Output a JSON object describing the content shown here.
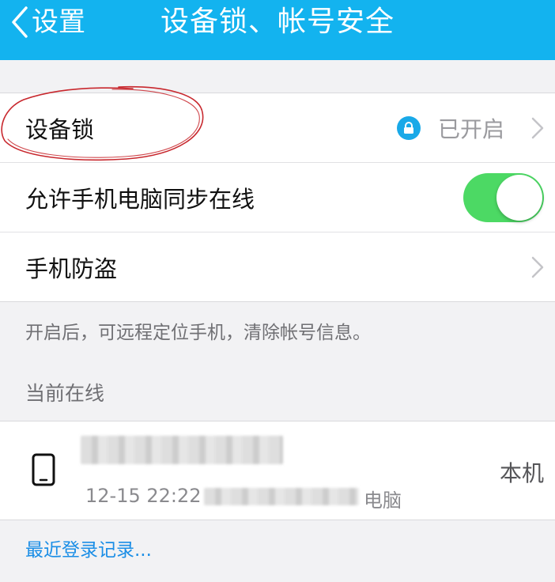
{
  "nav": {
    "back_label": "设置",
    "title": "设备锁、帐号安全"
  },
  "settings": {
    "device_lock": {
      "label": "设备锁",
      "value": "已开启"
    },
    "sync_online": {
      "label": "允许手机电脑同步在线",
      "enabled": true
    },
    "anti_theft": {
      "label": "手机防盗"
    }
  },
  "anti_theft_note": "开启后，可远程定位手机，清除帐号信息。",
  "online_section": {
    "title": "当前在线",
    "device": {
      "time": "12-15 22:22",
      "type": "电脑",
      "current_label": "本机"
    }
  },
  "recent_login_link": "最近登录记录...",
  "colors": {
    "nav_bg": "#13b3ef",
    "toggle_on": "#4cd964",
    "lock_icon": "#19a9e8",
    "link": "#1b8ee6",
    "annotation": "#c8282e"
  },
  "icons": {
    "back": "chevron-left-icon",
    "lock": "lock-icon",
    "disclosure": "chevron-right-icon",
    "device": "phone-icon"
  }
}
